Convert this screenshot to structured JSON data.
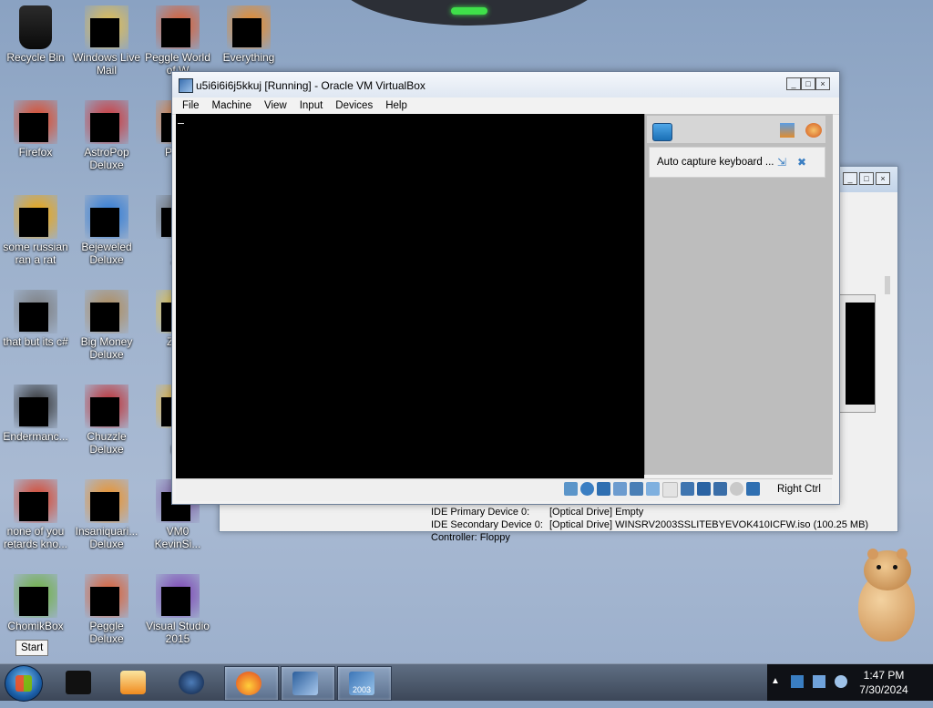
{
  "desktop": {
    "icons": [
      {
        "label": "Recycle Bin"
      },
      {
        "label": "Windows Live\nMail"
      },
      {
        "label": "Peggle World\nof W"
      },
      {
        "label": "Everything"
      },
      {
        "label": "Firefox"
      },
      {
        "label": "AstroPop\nDeluxe"
      },
      {
        "label": "Pegg\nD"
      },
      {
        "label": "some russian\nran a rat"
      },
      {
        "label": "Bejeweled\nDeluxe"
      },
      {
        "label": "Pl\nZo"
      },
      {
        "label": "that but its c#"
      },
      {
        "label": "Big Money\nDeluxe"
      },
      {
        "label": "Zum"
      },
      {
        "label": "Endermanc..."
      },
      {
        "label": "Chuzzle\nDeluxe"
      },
      {
        "label": "W\nKe"
      },
      {
        "label": "none of you\nretards kno..."
      },
      {
        "label": "Insaniquari...\nDeluxe"
      },
      {
        "label": "VM0\nKevinSi..."
      },
      {
        "label": "ChomikBox"
      },
      {
        "label": "Peggle Deluxe"
      },
      {
        "label": "Visual Studio\n2015"
      }
    ]
  },
  "vbox": {
    "title": "u5i6i6i6j5kkuj [Running] - Oracle VM VirtualBox",
    "menu": [
      "File",
      "Machine",
      "View",
      "Input",
      "Devices",
      "Help"
    ],
    "notice_text": "Auto capture keyboard ...",
    "host_key": "Right Ctrl"
  },
  "background_window": {
    "detail_row_1_key": "IDE Primary Device 0:",
    "detail_row_1_val": "[Optical Drive] Empty",
    "detail_row_2_key": "IDE Secondary Device 0:",
    "detail_row_2_val": "[Optical Drive] WINSRV2003SSLITEBYEVOK410ICFW.iso (100.25 MB)",
    "detail_row_3_key": "Controller: Floppy"
  },
  "tooltip": {
    "start": "Start"
  },
  "taskbar": {
    "pinned": [
      "Start",
      "App 1",
      "Media Player",
      "Network",
      "Firefox",
      "VirtualBox",
      "Windows Server 2003"
    ],
    "vm_badge": "2003",
    "time": "1:47 PM",
    "date": "7/30/2024"
  },
  "colors": {
    "accent": "#3a7ec2",
    "taskbar": "#4a566a",
    "vm_screen": "#000000"
  }
}
